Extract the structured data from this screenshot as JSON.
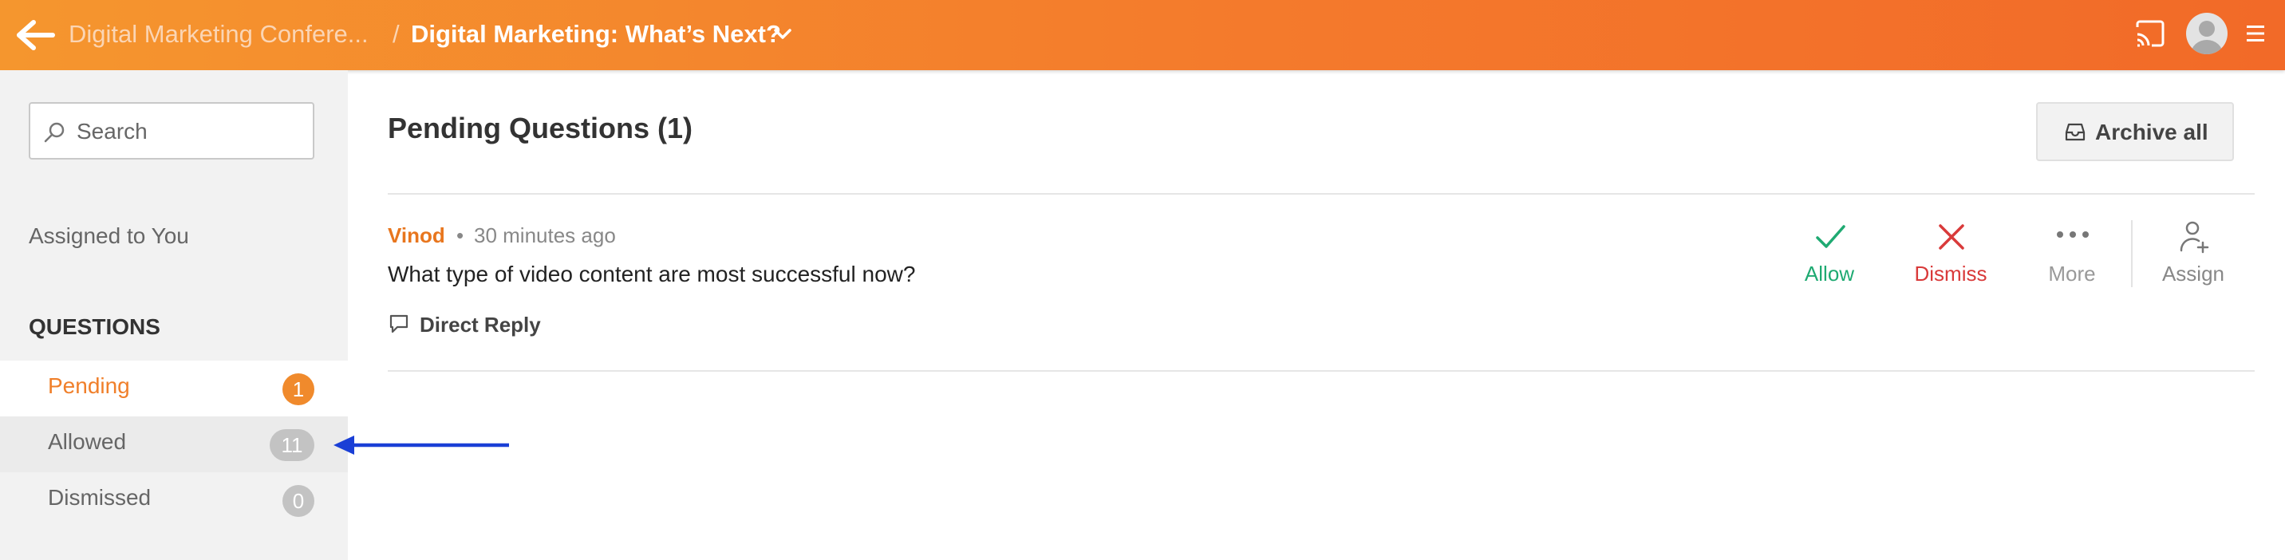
{
  "header": {
    "breadcrumb_parent": "Digital Marketing Confere...",
    "separator": "/",
    "current_session": "Digital Marketing: What’s Next?",
    "icons": {
      "back": "arrow-left-icon",
      "dropdown": "chevron-down-icon",
      "cast": "cast-icon",
      "avatar": "user-avatar",
      "menu": "hamburger-menu-icon"
    }
  },
  "sidebar": {
    "search_placeholder": "Search",
    "assigned_label": "Assigned to You",
    "section_title": "QUESTIONS",
    "items": [
      {
        "label": "Pending",
        "count": "1",
        "active": true
      },
      {
        "label": "Allowed",
        "count": "11",
        "active": false
      },
      {
        "label": "Dismissed",
        "count": "0",
        "active": false
      }
    ]
  },
  "main": {
    "title": "Pending Questions (1)",
    "archive_label": "Archive all",
    "questions": [
      {
        "author": "Vinod",
        "bullet": "•",
        "time": "30 minutes ago",
        "text": "What type of video content are most successful now?",
        "reply_label": "Direct Reply",
        "actions": {
          "allow": "Allow",
          "dismiss": "Dismiss",
          "more": "More",
          "assign": "Assign"
        }
      }
    ]
  },
  "colors": {
    "header_gradient_start": "#f5962e",
    "header_gradient_end": "#f26a28",
    "accent_orange": "#f08a2c",
    "allow_green": "#1faa72",
    "dismiss_red": "#d93a3a",
    "annotation_arrow": "#1a3fd6"
  }
}
